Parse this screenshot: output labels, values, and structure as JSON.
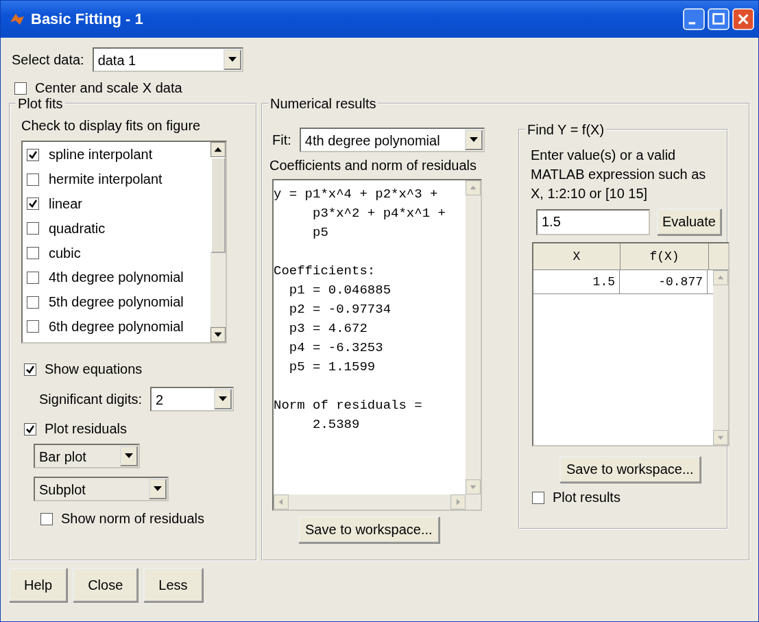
{
  "window": {
    "title": "Basic Fitting - 1"
  },
  "select_data": {
    "label": "Select data:",
    "value": "data 1"
  },
  "center_scale": {
    "label": "Center and scale X data",
    "checked": false
  },
  "plot_fits": {
    "title": "Plot fits",
    "hint": "Check to display fits on figure",
    "fits": [
      {
        "label": "spline interpolant",
        "checked": true
      },
      {
        "label": "hermite interpolant",
        "checked": false
      },
      {
        "label": "linear",
        "checked": true
      },
      {
        "label": "quadratic",
        "checked": false
      },
      {
        "label": "cubic",
        "checked": false
      },
      {
        "label": "4th degree polynomial",
        "checked": false
      },
      {
        "label": "5th degree polynomial",
        "checked": false
      },
      {
        "label": "6th degree polynomial",
        "checked": false
      }
    ],
    "show_equations": {
      "label": "Show equations",
      "checked": true
    },
    "significant_digits": {
      "label": "Significant digits:",
      "value": "2"
    },
    "plot_residuals": {
      "label": "Plot residuals",
      "checked": true
    },
    "residual_type": {
      "value": "Bar plot"
    },
    "residual_location": {
      "value": "Subplot"
    },
    "show_norm": {
      "label": "Show norm of residuals",
      "checked": false
    }
  },
  "numerical_results": {
    "title": "Numerical results",
    "fit_label": "Fit:",
    "fit_value": "4th degree polynomial",
    "coefficients_label": "Coefficients and norm of residuals",
    "blocks": [
      [
        "y = p1*x^4 + p2*x^3 +",
        "     p3*x^2 + p4*x^1 +",
        "     p5"
      ],
      [
        "Coefficients:",
        "  p1 = 0.046885",
        "  p2 = -0.97734",
        "  p3 = 4.672",
        "  p4 = -6.3253",
        "  p5 = 1.1599"
      ],
      [
        "Norm of residuals =",
        "     2.5389"
      ]
    ],
    "save_button": "Save to workspace..."
  },
  "find_y": {
    "title": "Find Y = f(X)",
    "instructions": "Enter value(s) or a valid MATLAB expression such as X, 1:2:10 or [10 15]",
    "input": "1.5",
    "evaluate_button": "Evaluate",
    "columns": [
      "X",
      "f(X)"
    ],
    "rows": [
      [
        "1.5",
        "-0.877"
      ]
    ],
    "save_button": "Save to workspace...",
    "plot_results": {
      "label": "Plot results",
      "checked": false
    }
  },
  "buttons": [
    "Help",
    "Close",
    "Less"
  ]
}
